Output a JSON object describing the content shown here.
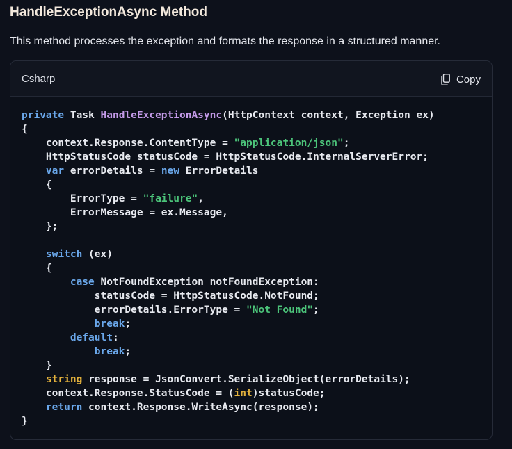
{
  "heading": "HandleExceptionAsync Method",
  "description": "This method processes the exception and formats the response in a structured manner.",
  "code_block": {
    "language": "Csharp",
    "copy_label": "Copy",
    "lines": [
      [
        [
          "kw",
          "private"
        ],
        [
          "p",
          " Task "
        ],
        [
          "fn",
          "HandleExceptionAsync"
        ],
        [
          "p",
          "(HttpContext context, Exception ex)"
        ]
      ],
      [
        [
          "p",
          "{"
        ]
      ],
      [
        [
          "p",
          "    context.Response.ContentType = "
        ],
        [
          "str",
          "\"application/json\""
        ],
        [
          "p",
          ";"
        ]
      ],
      [
        [
          "p",
          "    HttpStatusCode statusCode = HttpStatusCode.InternalServerError;"
        ]
      ],
      [
        [
          "p",
          "    "
        ],
        [
          "kw",
          "var"
        ],
        [
          "p",
          " errorDetails = "
        ],
        [
          "kw",
          "new"
        ],
        [
          "p",
          " ErrorDetails"
        ]
      ],
      [
        [
          "p",
          "    {"
        ]
      ],
      [
        [
          "p",
          "        ErrorType = "
        ],
        [
          "str",
          "\"failure\""
        ],
        [
          "p",
          ","
        ]
      ],
      [
        [
          "p",
          "        ErrorMessage = ex.Message,"
        ]
      ],
      [
        [
          "p",
          "    };"
        ]
      ],
      [
        [
          "p",
          ""
        ]
      ],
      [
        [
          "p",
          "    "
        ],
        [
          "kw",
          "switch"
        ],
        [
          "p",
          " (ex)"
        ]
      ],
      [
        [
          "p",
          "    {"
        ]
      ],
      [
        [
          "p",
          "        "
        ],
        [
          "kw",
          "case"
        ],
        [
          "p",
          " NotFoundException notFoundException:"
        ]
      ],
      [
        [
          "p",
          "            statusCode = HttpStatusCode.NotFound;"
        ]
      ],
      [
        [
          "p",
          "            errorDetails.ErrorType = "
        ],
        [
          "str",
          "\"Not Found\""
        ],
        [
          "p",
          ";"
        ]
      ],
      [
        [
          "p",
          "            "
        ],
        [
          "kw",
          "break"
        ],
        [
          "p",
          ";"
        ]
      ],
      [
        [
          "p",
          "        "
        ],
        [
          "kw",
          "default"
        ],
        [
          "p",
          ":"
        ]
      ],
      [
        [
          "p",
          "            "
        ],
        [
          "kw",
          "break"
        ],
        [
          "p",
          ";"
        ]
      ],
      [
        [
          "p",
          "    }"
        ]
      ],
      [
        [
          "p",
          "    "
        ],
        [
          "ty",
          "string"
        ],
        [
          "p",
          " response = JsonConvert.SerializeObject(errorDetails);"
        ]
      ],
      [
        [
          "p",
          "    context.Response.StatusCode = ("
        ],
        [
          "ty",
          "int"
        ],
        [
          "p",
          ")statusCode;"
        ]
      ],
      [
        [
          "p",
          "    "
        ],
        [
          "kw",
          "return"
        ],
        [
          "p",
          " context.Response.WriteAsync(response);"
        ]
      ],
      [
        [
          "p",
          "}"
        ]
      ]
    ]
  }
}
